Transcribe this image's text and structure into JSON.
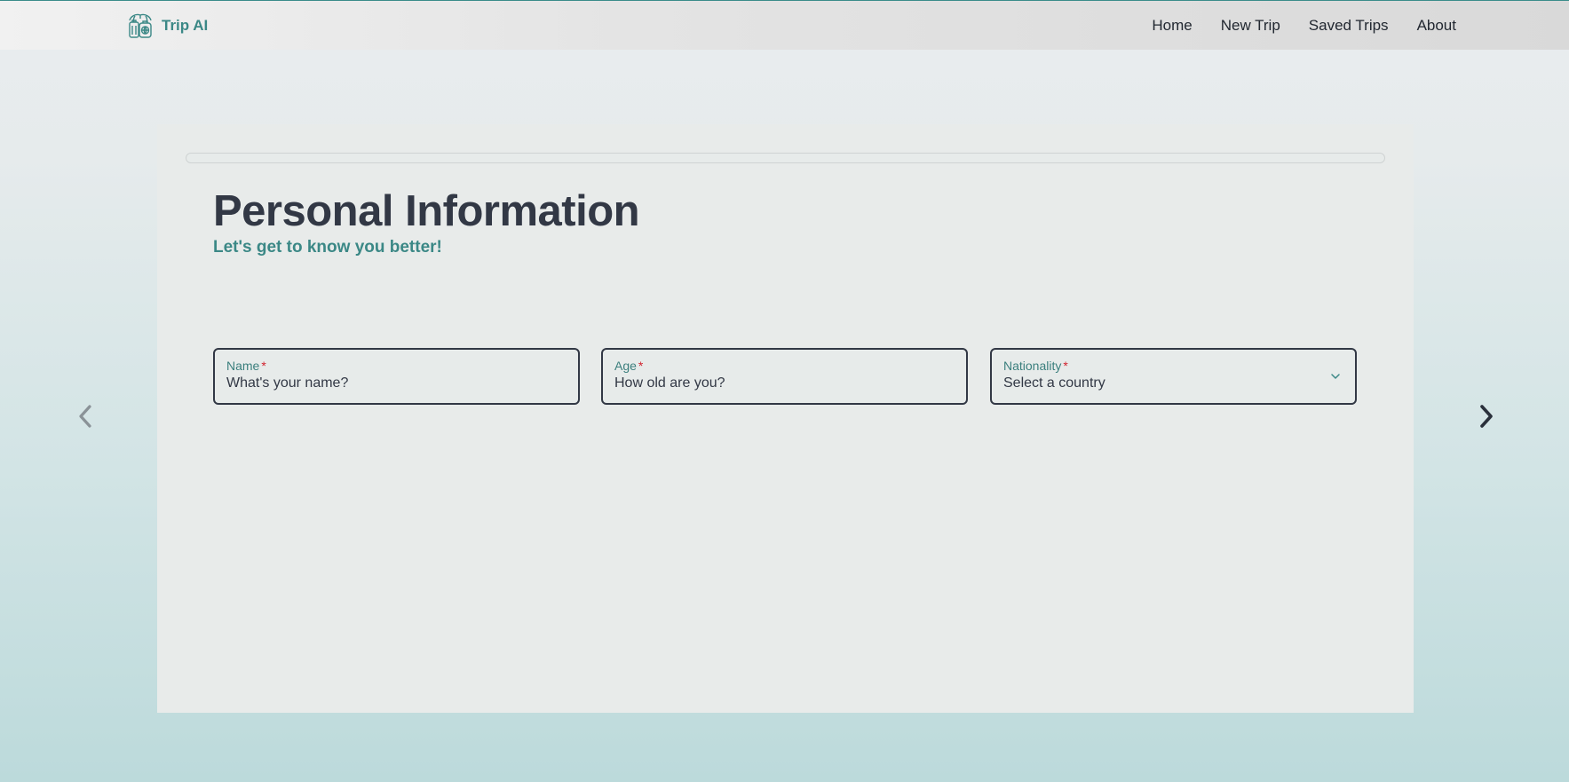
{
  "brand": {
    "name": "Trip AI"
  },
  "nav": {
    "items": [
      {
        "label": "Home"
      },
      {
        "label": "New Trip"
      },
      {
        "label": "Saved Trips"
      },
      {
        "label": "About"
      }
    ]
  },
  "form": {
    "progress": 0,
    "title": "Personal Information",
    "subtitle": "Let's get to know you better!",
    "fields": [
      {
        "label": "Name",
        "required_mark": "*",
        "placeholder": "What's your name?",
        "value": ""
      },
      {
        "label": "Age",
        "required_mark": "*",
        "placeholder": "How old are you?",
        "value": ""
      },
      {
        "label": "Nationality",
        "required_mark": "*",
        "selected": "Select a country"
      }
    ]
  },
  "icons": {
    "logo": "trip-ai-logo-icon",
    "prev": "chevron-left-icon",
    "next": "chevron-right-icon",
    "dropdown": "chevron-down-icon"
  },
  "colors": {
    "accent": "#3b8886",
    "text_dark": "#323845",
    "required": "#d1242f"
  }
}
